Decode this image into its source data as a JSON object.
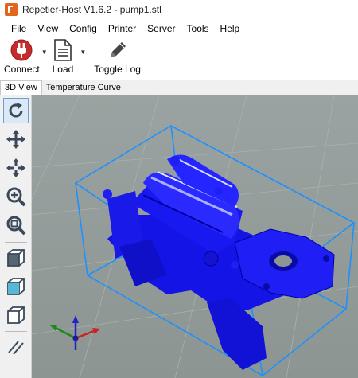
{
  "window": {
    "title": "Repetier-Host V1.6.2 - pump1.stl",
    "icon": "repetier-icon"
  },
  "menu": [
    "File",
    "View",
    "Config",
    "Printer",
    "Server",
    "Tools",
    "Help"
  ],
  "toolbar": {
    "connect_label": "Connect",
    "load_label": "Load",
    "toggle_log_label": "Toggle Log"
  },
  "tabs": [
    {
      "label": "3D View",
      "active": true
    },
    {
      "label": "Temperature Curve",
      "active": false
    }
  ],
  "side_tools": [
    {
      "icon": "reset-view-icon",
      "selected": true
    },
    {
      "icon": "move-icon",
      "selected": false
    },
    {
      "icon": "move-object-icon",
      "selected": false
    },
    {
      "icon": "zoom-in-icon",
      "selected": false
    },
    {
      "icon": "zoom-fit-icon",
      "selected": false
    },
    {
      "icon": "iso-view-icon",
      "selected": false
    },
    {
      "icon": "front-view-icon",
      "selected": false
    },
    {
      "icon": "side-view-icon",
      "selected": false
    },
    {
      "icon": "parallel-projection-icon",
      "selected": false
    }
  ],
  "colors": {
    "model": "#1414f0",
    "bounding_box": "#1e90ff",
    "background": "#939c9a",
    "connect_icon": "#c62b2b"
  }
}
